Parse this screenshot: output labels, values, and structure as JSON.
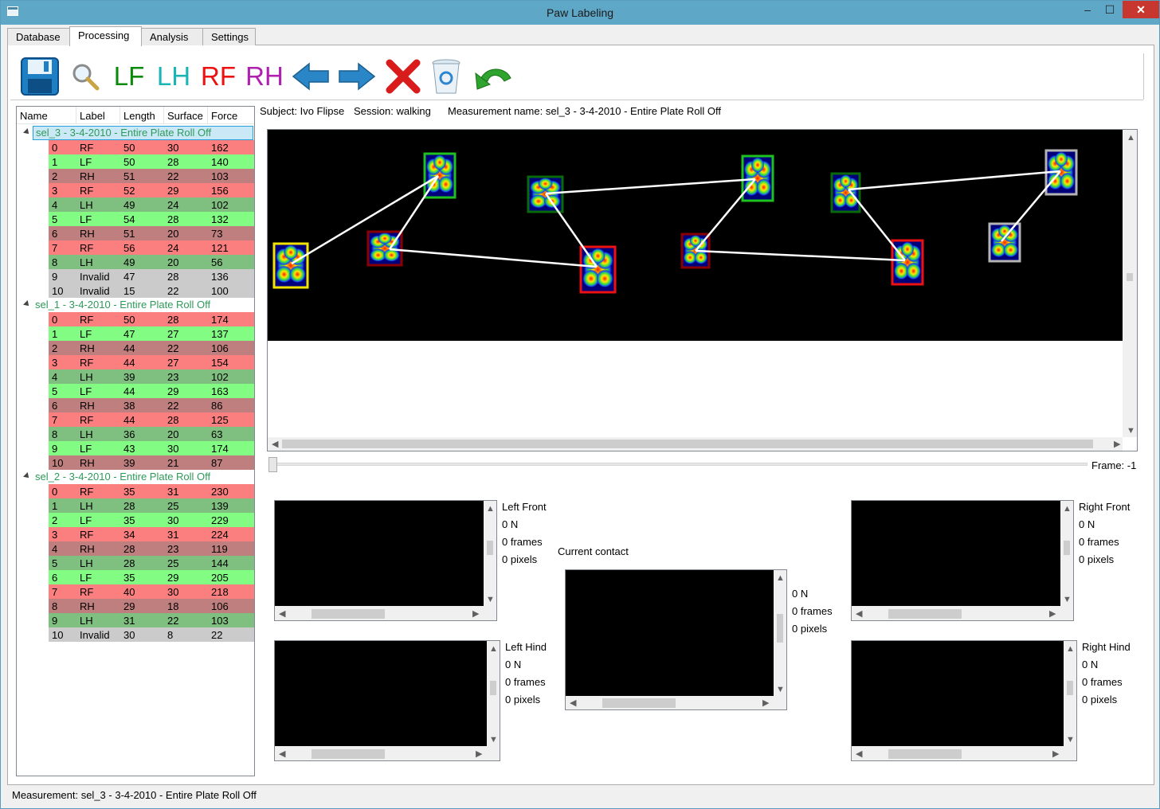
{
  "window": {
    "title": "Paw Labeling",
    "min": "–",
    "max": "☐",
    "close": "✕"
  },
  "tabs": [
    "Database",
    "Processing",
    "Analysis",
    "Settings"
  ],
  "toolbar": {
    "lf": "LF",
    "lh": "LH",
    "rf": "RF",
    "rh": "RH"
  },
  "colors": {
    "LF": "#0a8a0a",
    "LH": "#1ab6b6",
    "RF": "#ee1111",
    "RH": "#b020b0",
    "selection": "#cbe8f6"
  },
  "tree": {
    "headers": [
      "Name",
      "Label",
      "Length",
      "Surface",
      "Force"
    ],
    "groups": [
      {
        "name": "sel_3 - 3-4-2010 - Entire Plate Roll Off",
        "rows": [
          [
            "0",
            "RF",
            "50",
            "30",
            "162"
          ],
          [
            "1",
            "LF",
            "50",
            "28",
            "140"
          ],
          [
            "2",
            "RH",
            "51",
            "22",
            "103"
          ],
          [
            "3",
            "RF",
            "52",
            "29",
            "156"
          ],
          [
            "4",
            "LH",
            "49",
            "24",
            "102"
          ],
          [
            "5",
            "LF",
            "54",
            "28",
            "132"
          ],
          [
            "6",
            "RH",
            "51",
            "20",
            "73"
          ],
          [
            "7",
            "RF",
            "56",
            "24",
            "121"
          ],
          [
            "8",
            "LH",
            "49",
            "20",
            "56"
          ],
          [
            "9",
            "Invalid",
            "47",
            "28",
            "136"
          ],
          [
            "10",
            "Invalid",
            "15",
            "22",
            "100"
          ]
        ]
      },
      {
        "name": "sel_1 - 3-4-2010 - Entire Plate Roll Off",
        "rows": [
          [
            "0",
            "RF",
            "50",
            "28",
            "174"
          ],
          [
            "1",
            "LF",
            "47",
            "27",
            "137"
          ],
          [
            "2",
            "RH",
            "44",
            "22",
            "106"
          ],
          [
            "3",
            "RF",
            "44",
            "27",
            "154"
          ],
          [
            "4",
            "LH",
            "39",
            "23",
            "102"
          ],
          [
            "5",
            "LF",
            "44",
            "29",
            "163"
          ],
          [
            "6",
            "RH",
            "38",
            "22",
            "86"
          ],
          [
            "7",
            "RF",
            "44",
            "28",
            "125"
          ],
          [
            "8",
            "LH",
            "36",
            "20",
            "63"
          ],
          [
            "9",
            "LF",
            "43",
            "30",
            "174"
          ],
          [
            "10",
            "RH",
            "39",
            "21",
            "87"
          ]
        ]
      },
      {
        "name": "sel_2 - 3-4-2010 - Entire Plate Roll Off",
        "rows": [
          [
            "0",
            "RF",
            "35",
            "31",
            "230"
          ],
          [
            "1",
            "LH",
            "28",
            "25",
            "139"
          ],
          [
            "2",
            "LF",
            "35",
            "30",
            "229"
          ],
          [
            "3",
            "RF",
            "34",
            "31",
            "224"
          ],
          [
            "4",
            "RH",
            "28",
            "23",
            "119"
          ],
          [
            "5",
            "LH",
            "28",
            "25",
            "144"
          ],
          [
            "6",
            "LF",
            "35",
            "29",
            "205"
          ],
          [
            "7",
            "RF",
            "40",
            "30",
            "218"
          ],
          [
            "8",
            "RH",
            "29",
            "18",
            "106"
          ],
          [
            "9",
            "LH",
            "31",
            "22",
            "103"
          ],
          [
            "10",
            "Invalid",
            "30",
            "8",
            "22"
          ]
        ]
      }
    ]
  },
  "info": {
    "subject": "Subject: Ivo Flipse",
    "session": "Session: walking",
    "measurement": "Measurement name: sel_3 - 3-4-2010 - Entire Plate Roll Off"
  },
  "frame": "Frame: -1",
  "contacts": {
    "left_front": {
      "title": "Left Front",
      "force": "0 N",
      "frames": "0 frames",
      "pixels": "0 pixels"
    },
    "left_hind": {
      "title": "Left Hind",
      "force": "0 N",
      "frames": "0 frames",
      "pixels": "0 pixels"
    },
    "current": {
      "title": "Current contact",
      "force": "0 N",
      "frames": "0 frames",
      "pixels": "0 pixels"
    },
    "right_front": {
      "title": "Right Front",
      "force": "0 N",
      "frames": "0 frames",
      "pixels": "0 pixels"
    },
    "right_hind": {
      "title": "Right Hind",
      "force": "0 N",
      "frames": "0 frames",
      "pixels": "0 pixels"
    }
  },
  "status": "Measurement: sel_3 - 3-4-2010 - Entire Plate Roll Off"
}
